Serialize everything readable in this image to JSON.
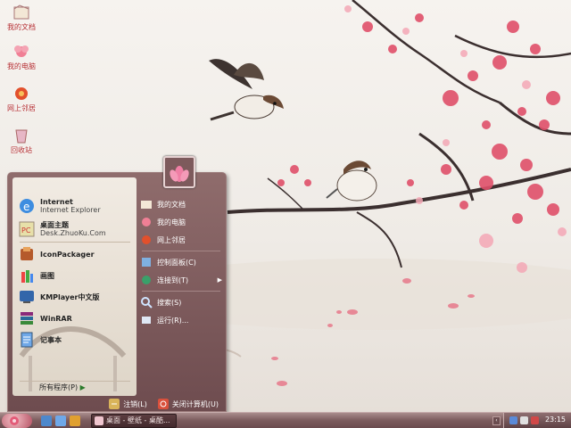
{
  "desktop": {
    "icons": [
      {
        "label": "我的文档",
        "icon": "my-documents-icon"
      },
      {
        "label": "我的电脑",
        "icon": "my-computer-icon"
      },
      {
        "label": "网上邻居",
        "icon": "network-places-icon"
      },
      {
        "label": "回收站",
        "icon": "recycle-bin-icon"
      }
    ]
  },
  "start_menu": {
    "pinned": [
      {
        "title": "Internet",
        "subtitle": "Internet Explorer",
        "icon": "internet-explorer-icon"
      },
      {
        "title": "桌面主题",
        "subtitle": "Desk.ZhuoKu.Com",
        "icon": "desktop-theme-icon"
      }
    ],
    "recent": [
      {
        "title": "IconPackager",
        "icon": "iconpackager-icon"
      },
      {
        "title": "画图",
        "icon": "paint-icon"
      },
      {
        "title": "KMPlayer中文版",
        "icon": "kmplayer-icon"
      },
      {
        "title": "WinRAR",
        "icon": "winrar-icon"
      },
      {
        "title": "记事本",
        "icon": "notepad-icon"
      }
    ],
    "all_programs": "所有程序(P)",
    "places": [
      {
        "label": "我的文档",
        "icon": "my-documents-icon"
      },
      {
        "label": "我的电脑",
        "icon": "my-computer-icon"
      },
      {
        "label": "网上邻居",
        "icon": "network-places-icon"
      },
      {
        "label": "控制面板(C)",
        "icon": "control-panel-icon"
      },
      {
        "label": "连接到(T)",
        "icon": "connect-to-icon",
        "submenu": true
      },
      {
        "label": "搜索(S)",
        "icon": "search-icon"
      },
      {
        "label": "运行(R)...",
        "icon": "run-icon"
      }
    ],
    "logoff": "注销(L)",
    "shutdown": "关闭计算机(U)"
  },
  "taskbar": {
    "active_task": "桌面 - 壁纸 - 桌酷...",
    "clock": "23:15",
    "expand_arrow": "‹"
  },
  "colors": {
    "accent": "#b0282a",
    "menu_bg": "#7d5a5c",
    "blossom": "#e0506a"
  }
}
